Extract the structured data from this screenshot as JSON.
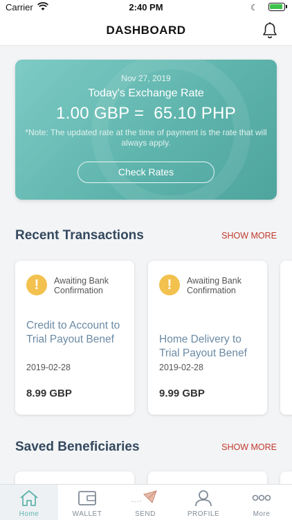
{
  "status_bar": {
    "carrier": "Carrier",
    "time": "2:40 PM"
  },
  "header": {
    "title": "DASHBOARD"
  },
  "rate_card": {
    "date": "Nov 27, 2019",
    "heading": "Today's Exchange Rate",
    "rate": "1.00 GBP =  65.10 PHP",
    "note": "*Note: The updated rate at the time of payment is the rate that will always apply.",
    "button_label": "Check Rates"
  },
  "recent_transactions": {
    "title": "Recent Transactions",
    "show_more": "SHOW MORE",
    "items": [
      {
        "status": "Awaiting Bank Confirmation",
        "title": "Credit to Account to Trial Payout Benef",
        "date": "2019-02-28",
        "amount": "8.99 GBP"
      },
      {
        "status": "Awaiting Bank Confirmation",
        "title": "Home Delivery to Trial Payout Benef",
        "date": "2019-02-28",
        "amount": "9.99 GBP"
      }
    ]
  },
  "saved_beneficiaries": {
    "title": "Saved Beneficiaries",
    "show_more": "SHOW MORE"
  },
  "tabs": [
    {
      "label": "Home",
      "icon": "home-icon",
      "active": true
    },
    {
      "label": "WALLET",
      "icon": "wallet-icon",
      "active": false
    },
    {
      "label": "SEND",
      "icon": "send-icon",
      "active": false
    },
    {
      "label": "PROFILE",
      "icon": "profile-icon",
      "active": false
    },
    {
      "label": "More",
      "icon": "more-icon",
      "active": false
    }
  ],
  "colors": {
    "accent": "#5fb5ad",
    "warning": "#f2c14e",
    "link_red": "#c0392b",
    "title_blue": "#6b8aa5"
  }
}
